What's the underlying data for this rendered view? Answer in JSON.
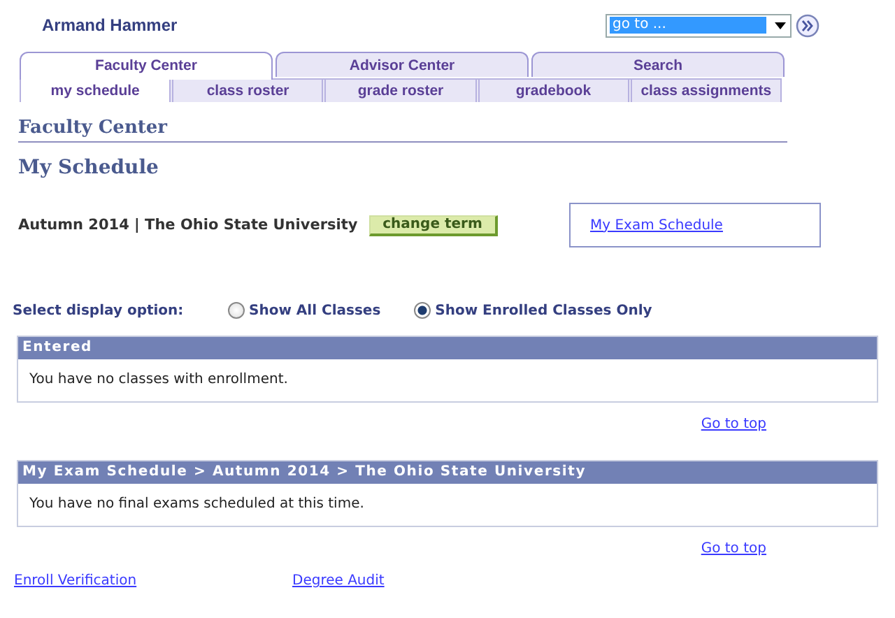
{
  "user_name": "Armand  Hammer",
  "goto": {
    "value": "go to ..."
  },
  "tabs": [
    {
      "label": "Faculty Center",
      "selected": true
    },
    {
      "label": "Advisor Center",
      "selected": false
    },
    {
      "label": "Search",
      "selected": false
    }
  ],
  "subtabs": [
    {
      "label": "my schedule",
      "selected": true
    },
    {
      "label": "class roster",
      "selected": false
    },
    {
      "label": "grade roster",
      "selected": false
    },
    {
      "label": "gradebook",
      "selected": false
    },
    {
      "label": "class assignments",
      "selected": false
    }
  ],
  "page_title": "Faculty Center",
  "heading": "My Schedule",
  "term": "Autumn 2014 | The Ohio State University",
  "change_term_button": "change term",
  "exam_link": "My Exam Schedule",
  "display_option": {
    "label": "Select display option:",
    "options": [
      {
        "label": "Show All Classes",
        "selected": false
      },
      {
        "label": "Show Enrolled Classes Only",
        "selected": true
      }
    ]
  },
  "panels": [
    {
      "title": "Entered",
      "message": "You have no classes with enrollment.",
      "link": "Go to top"
    },
    {
      "title": "My Exam Schedule > Autumn 2014 > The Ohio State University",
      "message": "You have no final exams scheduled at this time.",
      "link": "Go to top"
    }
  ],
  "footer_links": [
    "Enroll Verification",
    "Degree Audit"
  ]
}
